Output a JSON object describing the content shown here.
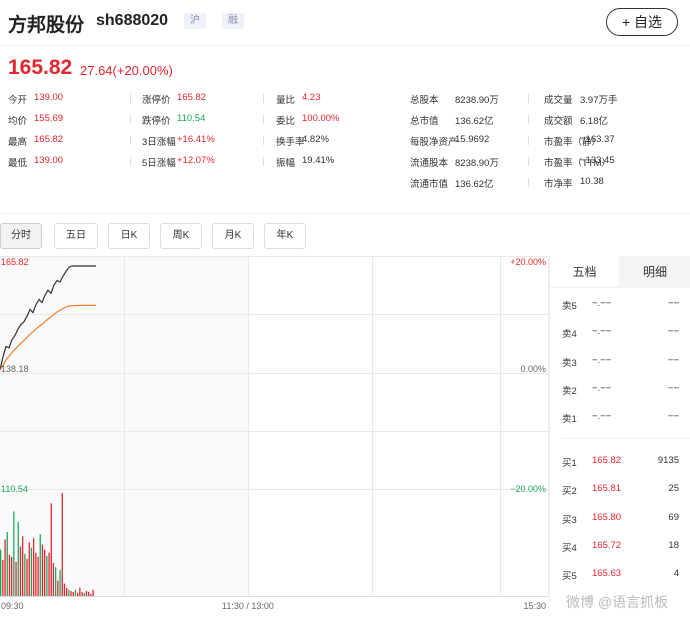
{
  "header": {
    "name": "方邦股份",
    "code": "sh688020",
    "tag1": "沪",
    "tag2": "融",
    "add_label": "+ 自选"
  },
  "quote": {
    "price": "165.82",
    "change": "27.64(+20.00%)"
  },
  "stats": {
    "col1": [
      {
        "label": "今开",
        "value": "139.00",
        "color": "#e3262e"
      },
      {
        "label": "均价",
        "value": "155.69",
        "color": "#e3262e"
      },
      {
        "label": "最高",
        "value": "165.82",
        "color": "#e3262e"
      },
      {
        "label": "最低",
        "value": "139.00",
        "color": "#e3262e"
      }
    ],
    "col2": [
      {
        "label": "涨停价",
        "value": "165.82",
        "color": "#e3262e"
      },
      {
        "label": "跌停价",
        "value": "110.54",
        "color": "#1aa65a"
      },
      {
        "label": "3日涨幅",
        "value": "+16.41%",
        "color": "#e3262e"
      },
      {
        "label": "5日涨幅",
        "value": "+12.07%",
        "color": "#e3262e"
      }
    ],
    "col3": [
      {
        "label": "量比",
        "value": "4.23",
        "color": "#e3262e"
      },
      {
        "label": "委比",
        "value": "100.00%",
        "color": "#e3262e"
      },
      {
        "label": "换手率",
        "value": "4.82%",
        "color": "#333333"
      },
      {
        "label": "振幅",
        "value": "19.41%",
        "color": "#333333"
      }
    ],
    "col4": [
      {
        "label": "总股本",
        "value": "8238.90万"
      },
      {
        "label": "总市值",
        "value": "136.62亿"
      },
      {
        "label": "每股净资产",
        "value": "15.9692"
      },
      {
        "label": "流通股本",
        "value": "8238.90万"
      },
      {
        "label": "流通市值",
        "value": "136.62亿"
      }
    ],
    "col5": [
      {
        "label": "成交量",
        "value": "3.97万手"
      },
      {
        "label": "成交额",
        "value": "6.18亿"
      },
      {
        "label": "市盈率（静）",
        "value": "−163.37"
      },
      {
        "label": "市盈率（TTM）",
        "value": "−133.45"
      },
      {
        "label": "市净率",
        "value": "10.38"
      }
    ]
  },
  "tabs": [
    "分时",
    "五日",
    "日K",
    "周K",
    "月K",
    "年K"
  ],
  "active_tab": "分时",
  "orderbook": {
    "tabs": [
      "五档",
      "明细"
    ],
    "sells": [
      {
        "label": "卖5",
        "price": "−.−−",
        "vol": "−−"
      },
      {
        "label": "卖4",
        "price": "−.−−",
        "vol": "−−"
      },
      {
        "label": "卖3",
        "price": "−.−−",
        "vol": "−−"
      },
      {
        "label": "卖2",
        "price": "−.−−",
        "vol": "−−"
      },
      {
        "label": "卖1",
        "price": "−.−−",
        "vol": "−−"
      }
    ],
    "buys": [
      {
        "label": "买1",
        "price": "165.82",
        "vol": "9135"
      },
      {
        "label": "买2",
        "price": "165.81",
        "vol": "25"
      },
      {
        "label": "买3",
        "price": "165.80",
        "vol": "69"
      },
      {
        "label": "买4",
        "price": "165.72",
        "vol": "18"
      },
      {
        "label": "买5",
        "price": "165.63",
        "vol": "4"
      }
    ]
  },
  "chart_data": {
    "type": "line",
    "title": "",
    "left_labels": {
      "top": "165.82",
      "mid": "138.18",
      "bottom": "110.54"
    },
    "right_labels": {
      "top": "+20.00%",
      "mid": "0.00%",
      "bottom": "−20.00%"
    },
    "time_labels": [
      "09:30",
      "11:30 / 13:00",
      "15:30"
    ],
    "ylim": [
      110.54,
      165.82
    ],
    "series": [
      {
        "color": "#333333",
        "values": [
          139.0,
          142.5,
          145.1,
          144.8,
          146.9,
          148.0,
          149.6,
          150.8,
          151.5,
          152.9,
          154.6,
          153.8,
          155.9,
          157.2,
          156.4,
          158.3,
          159.6,
          158.8,
          160.9,
          162.1,
          161.7,
          163.2,
          164.4,
          165.5,
          165.82,
          165.82,
          165.82,
          165.82,
          165.82,
          165.82,
          165.82,
          165.82,
          165.82
        ]
      },
      {
        "color": "#f07d32",
        "values": [
          139.0,
          140.3,
          141.7,
          142.6,
          143.6,
          144.4,
          145.2,
          146.0,
          146.7,
          147.5,
          148.3,
          148.9,
          149.6,
          150.3,
          150.8,
          151.5,
          152.2,
          152.7,
          153.4,
          154.0,
          154.4,
          154.9,
          155.3,
          155.5,
          155.6,
          155.65,
          155.67,
          155.68,
          155.69,
          155.69,
          155.69,
          155.69,
          155.69
        ]
      }
    ],
    "volume": [
      0.45,
      0.35,
      0.55,
      0.62,
      0.4,
      0.38,
      0.82,
      0.33,
      0.72,
      0.48,
      0.58,
      0.41,
      0.36,
      0.52,
      0.47,
      0.56,
      0.42,
      0.38,
      0.6,
      0.5,
      0.45,
      0.39,
      0.42,
      0.9,
      0.32,
      0.28,
      0.15,
      0.25,
      1.0,
      0.12,
      0.08,
      0.06,
      0.05,
      0.04,
      0.06,
      0.03,
      0.08,
      0.04,
      0.03,
      0.05,
      0.04,
      0.02,
      0.06
    ],
    "volume_colors": [
      "#1aa65a",
      "#e3262e",
      "#e3262e",
      "#1aa65a",
      "#e3262e",
      "#e3262e",
      "#1aa65a",
      "#e3262e",
      "#1aa65a",
      "#e3262e",
      "#e3262e",
      "#1aa65a",
      "#e3262e",
      "#e3262e",
      "#1aa65a",
      "#e3262e",
      "#e3262e",
      "#e3262e",
      "#1aa65a",
      "#e3262e",
      "#e3262e",
      "#1aa65a",
      "#e3262e",
      "#e3262e",
      "#e3262e",
      "#1aa65a",
      "#e3262e",
      "#1aa65a",
      "#e3262e",
      "#e3262e",
      "#e3262e",
      "#1aa65a",
      "#e3262e",
      "#e3262e",
      "#1aa65a",
      "#e3262e",
      "#e3262e",
      "#e3262e",
      "#1aa65a",
      "#e3262e",
      "#e3262e",
      "#e3262e",
      "#e3262e"
    ]
  },
  "watermark": "微博 @语言抓板"
}
